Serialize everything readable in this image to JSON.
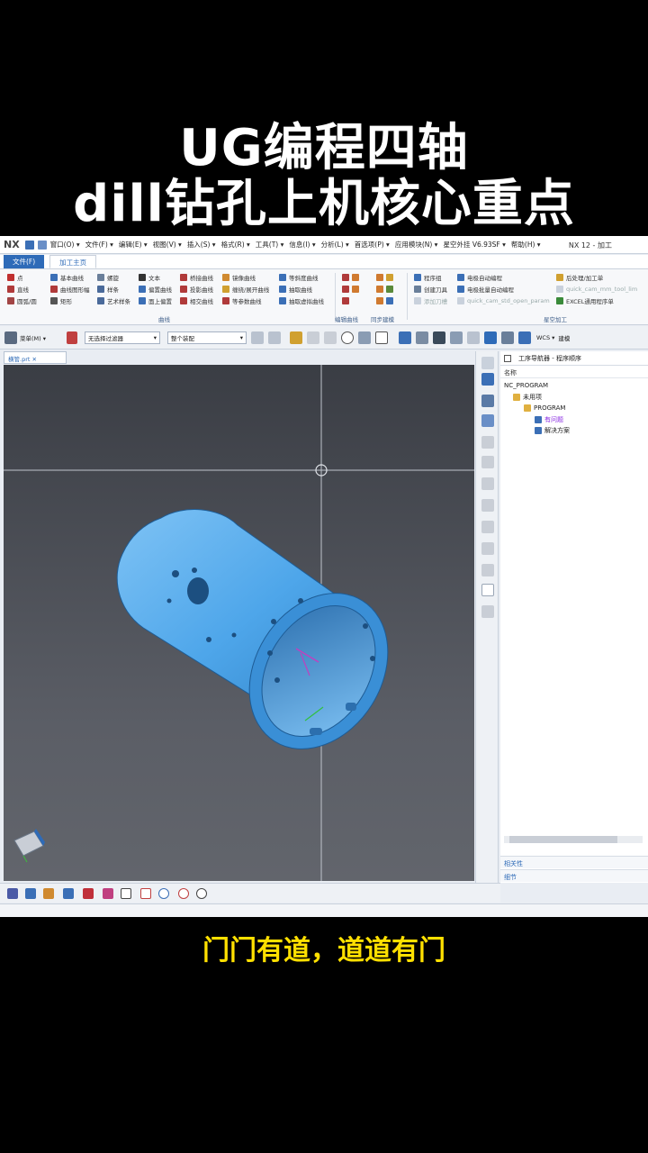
{
  "title": {
    "line1": "UG编程四轴",
    "line2": "dill钻孔上机核心重点"
  },
  "subtitle": "门门有道，道道有门",
  "app": {
    "logo": "NX",
    "window_title": "NX 12 - 加工",
    "menu": [
      "窗口(O) ▾",
      "文件(F) ▾",
      "编辑(E) ▾",
      "视图(V) ▾",
      "插入(S) ▾",
      "格式(R) ▾",
      "工具(T) ▾",
      "信息(I) ▾",
      "分析(L) ▾",
      "首选项(P) ▾",
      "应用模块(N) ▾",
      "星空外挂 V6.93SF ▾",
      "帮助(H) ▾"
    ],
    "ribbon_tabs": {
      "file": "文件(F)",
      "main": "加工主页"
    },
    "ribbon": {
      "col1": [
        "点",
        "直线",
        "圆弧/圆"
      ],
      "col2": [
        "基本曲线",
        "曲线图形幅",
        "矩形"
      ],
      "col3": [
        "螺旋",
        "样条",
        "艺术样条"
      ],
      "col4": [
        "文本",
        "偏置曲线",
        "面上偏置"
      ],
      "col5": [
        "桥接曲线",
        "投影曲线",
        "相交曲线"
      ],
      "col6": [
        "镜像曲线",
        "缠绕/展开曲线",
        "等参数曲线"
      ],
      "col7": [
        "等斜度曲线",
        "抽取曲线",
        "抽取虚拟曲线"
      ],
      "col8": [
        "程序组",
        "创建刀具",
        "添加刀槽"
      ],
      "col9": [
        "电极自动编程",
        "电极批量自动编程",
        "quick_cam_std_open_param"
      ],
      "col10": [
        "后处理/加工单",
        "quick_cam_mm_tool_lim",
        "EXCEL通用程序单"
      ],
      "group_labels": {
        "curve": "曲线",
        "edit_curve": "编辑曲线",
        "sync": "同步建模",
        "xk": "星空加工"
      }
    },
    "toolbar2": {
      "menu_label": "菜单(M) ▾",
      "filter": "无选择过滤器",
      "scope": "整个装配",
      "wcs": "WCS ▾",
      "build": "建模"
    },
    "doc_tab": "横管.prt",
    "navigator": {
      "header": "工序导航器 - 程序顺序",
      "column": "名称",
      "tree": [
        {
          "label": "NC_PROGRAM",
          "indent": 0,
          "color": "#222222",
          "icon": "none"
        },
        {
          "label": "未用项",
          "indent": 10,
          "color": "#222222",
          "icon": "folder-icon"
        },
        {
          "label": "PROGRAM",
          "indent": 22,
          "color": "#222222",
          "icon": "folder-icon"
        },
        {
          "label": "有问题",
          "indent": 34,
          "color": "#8a2be2",
          "icon": "operation-icon"
        },
        {
          "label": "解决方案",
          "indent": 34,
          "color": "#222222",
          "icon": "operation-icon"
        }
      ],
      "sections": [
        "相关性",
        "细节"
      ]
    }
  },
  "colors": {
    "part": "#4ea6ea",
    "part_dark": "#2d7fc4",
    "ribbon_blue": "#2e6bb8"
  }
}
